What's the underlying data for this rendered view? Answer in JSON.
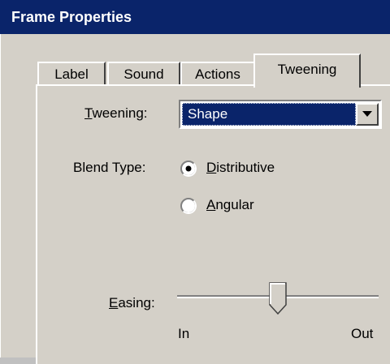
{
  "window": {
    "title": "Frame Properties"
  },
  "tabs": [
    {
      "label": "Label"
    },
    {
      "label": "Sound"
    },
    {
      "label": "Actions"
    },
    {
      "label": "Tweening",
      "active": true
    }
  ],
  "tweening": {
    "field_label": "Tweening:",
    "mnemonic": "T",
    "label_rest": "weening:",
    "selected": "Shape"
  },
  "blend_type": {
    "label": "Blend Type:",
    "options": [
      {
        "mnemonic": "D",
        "rest": "istributive",
        "full": "Distributive",
        "checked": true
      },
      {
        "mnemonic": "A",
        "rest": "ngular",
        "full": "Angular",
        "checked": false
      }
    ]
  },
  "easing": {
    "label": "Easing:",
    "mnemonic": "E",
    "label_rest": "asing:",
    "min_label": "In",
    "max_label": "Out",
    "value_fraction": 0.5
  },
  "colors": {
    "titlebar": "#0a246a",
    "face": "#d4d0c8",
    "selection": "#0a246a"
  }
}
